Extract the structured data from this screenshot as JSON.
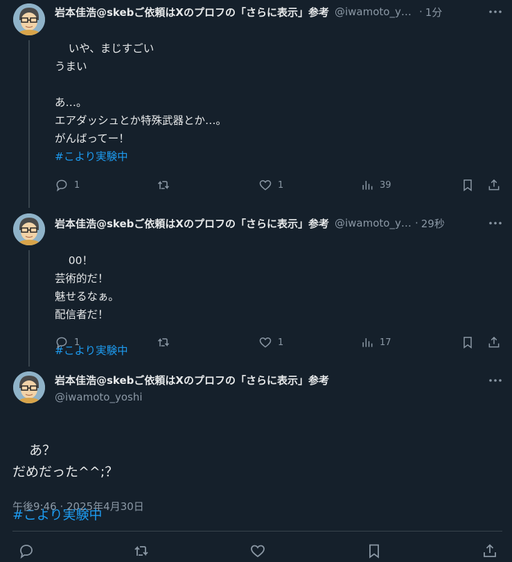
{
  "tweets": [
    {
      "name": "岩本佳浩@skebご依頼はXのプロフの「さらに表示」参考",
      "handle": "@iwamoto_yoshi",
      "time": "1分",
      "text": "いや、まじすごい\nうまい\n\nあ…。\nエアダッシュとか特殊武器とか…。\nがんばってー！\n",
      "hashtag": "#こより実験中",
      "reply_count": "1",
      "retweet_count": "",
      "like_count": "1",
      "view_count": "39"
    },
    {
      "name": "岩本佳浩@skebご依頼はXのプロフの「さらに表示」参考",
      "handle": "@iwamoto_yoshi",
      "time": "29秒",
      "text": "00！\n芸術的だ！\n魅せるなぁ。\n配信者だ！",
      "hashtag": "#こより実験中",
      "reply_count": "1",
      "retweet_count": "",
      "like_count": "1",
      "view_count": "17"
    }
  ],
  "main_tweet": {
    "name": "岩本佳浩@skebご依頼はXのプロフの「さらに表示」参考",
    "handle": "@iwamoto_yoshi",
    "text": "あ？\nだめだった^^;？",
    "hashtag": "#こより実験中",
    "timestamp": "午後9:46 · 2025年4月30日"
  },
  "separator": "·",
  "more_glyph": "•••",
  "colors": {
    "background": "#15202b",
    "text": "#e7e9ea",
    "muted": "#8b98a5",
    "link": "#1d9bf0",
    "border": "#38444d"
  },
  "icons": [
    "reply-icon",
    "retweet-icon",
    "like-icon",
    "views-icon",
    "bookmark-icon",
    "share-icon",
    "more-icon"
  ]
}
